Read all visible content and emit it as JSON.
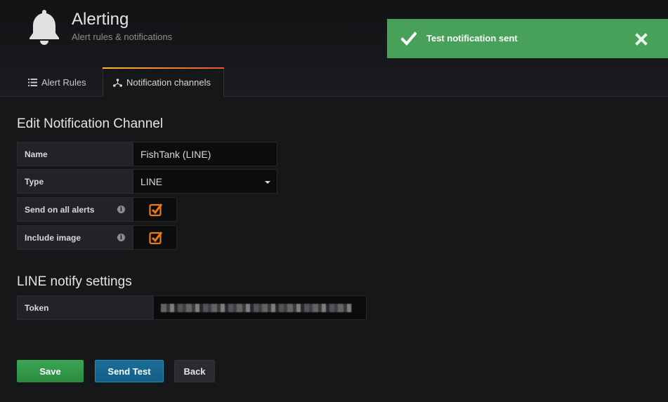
{
  "header": {
    "title": "Alerting",
    "subtitle": "Alert rules & notifications",
    "icon": "bell-icon"
  },
  "tabs": [
    {
      "label": "Alert Rules",
      "icon": "list-icon",
      "active": false
    },
    {
      "label": "Notification channels",
      "icon": "share-icon",
      "active": true
    }
  ],
  "toast": {
    "message": "Test notification sent",
    "color": "#48a158",
    "icon": "check-icon",
    "close_icon": "close-icon"
  },
  "form": {
    "heading": "Edit Notification Channel",
    "name_label": "Name",
    "name_value": "FishTank (LINE)",
    "type_label": "Type",
    "type_value": "LINE",
    "send_all_label": "Send on all alerts",
    "send_all_checked": true,
    "include_image_label": "Include image",
    "include_image_checked": true
  },
  "line_settings": {
    "heading": "LINE notify settings",
    "token_label": "Token"
  },
  "buttons": {
    "save": "Save",
    "send_test": "Send Test",
    "back": "Back"
  },
  "colors": {
    "accent_orange": "#eb7b18",
    "save_green": "#3aa655",
    "send_test_blue": "#1b6e9a"
  }
}
